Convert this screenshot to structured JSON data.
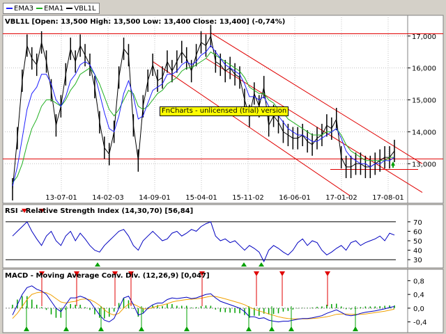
{
  "legend": {
    "items": [
      {
        "label": "EMA3",
        "color": "#2020ff"
      },
      {
        "label": "EMA1",
        "color": "#20b020"
      },
      {
        "label": "VBL1L",
        "color": "#000000"
      }
    ]
  },
  "watermark": "FnCharts - unlicensed (trial) version",
  "chart_data": [
    {
      "type": "line",
      "title": "VBL1L [Open: 13,500  High: 13,500  Low: 13,400  Close: 13,400] (-0,74%)",
      "x_tick_labels": [
        "13-07-01",
        "14-02-03",
        "14-09-01",
        "15-04-01",
        "15-11-02",
        "16-06-01",
        "17-01-02",
        "17-08-01"
      ],
      "y_tick_labels": [
        "17,000",
        "16,000",
        "15,000",
        "14,000",
        "13,000"
      ],
      "ylim": [
        12.2,
        17.3
      ],
      "series": [
        {
          "name": "VBL1L",
          "color": "#000000",
          "values": [
            12.2,
            13.8,
            15.6,
            16.7,
            16.3,
            16.1,
            16.8,
            16.2,
            15.3,
            14.2,
            14.8,
            15.8,
            16.6,
            16.2,
            16.7,
            16.4,
            16.1,
            15.4,
            14.3,
            13.5,
            13.3,
            14.0,
            15.7,
            16.6,
            16.4,
            14.2,
            13.1,
            14.8,
            15.6,
            16.1,
            15.6,
            15.7,
            16.2,
            15.9,
            16.2,
            16.5,
            16.3,
            15.9,
            16.4,
            16.8,
            16.7,
            17.0,
            16.2,
            16.1,
            15.9,
            16.0,
            15.8,
            15.7,
            15.0,
            14.5,
            15.2,
            14.8,
            15.4,
            14.2,
            14.5,
            14.3,
            14.0,
            13.9,
            13.8,
            13.8,
            13.9,
            13.7,
            13.6,
            13.8,
            13.9,
            14.2,
            14.1,
            14.4,
            13.2,
            12.9,
            12.9,
            13.0,
            13.0,
            12.9,
            12.9,
            13.0,
            13.1,
            13.2,
            13.2,
            13.4
          ]
        },
        {
          "name": "EMA3",
          "color": "#2020ff",
          "values": [
            12.3,
            12.9,
            13.8,
            14.7,
            15.2,
            15.4,
            15.8,
            15.8,
            15.5,
            15.0,
            14.8,
            15.1,
            15.6,
            15.8,
            16.1,
            16.2,
            16.1,
            15.8,
            15.2,
            14.6,
            14.1,
            14.0,
            14.5,
            15.2,
            15.6,
            15.1,
            14.4,
            14.5,
            14.9,
            15.3,
            15.4,
            15.5,
            15.8,
            15.8,
            15.9,
            16.1,
            16.2,
            16.1,
            16.2,
            16.4,
            16.5,
            16.7,
            16.5,
            16.3,
            16.1,
            16.0,
            15.9,
            15.8,
            15.5,
            15.1,
            15.1,
            15.0,
            15.1,
            14.8,
            14.7,
            14.5,
            14.3,
            14.1,
            14.0,
            13.9,
            13.9,
            13.8,
            13.7,
            13.7,
            13.8,
            13.9,
            14.0,
            14.1,
            13.8,
            13.4,
            13.2,
            13.1,
            13.0,
            13.0,
            12.9,
            13.0,
            13.0,
            13.1,
            13.1,
            13.2
          ]
        },
        {
          "name": "EMA1",
          "color": "#20b020",
          "values": [
            12.4,
            12.6,
            13.0,
            13.6,
            14.1,
            14.4,
            14.8,
            15.0,
            15.0,
            14.9,
            14.8,
            15.0,
            15.3,
            15.5,
            15.8,
            15.9,
            16.0,
            15.8,
            15.5,
            15.1,
            14.7,
            14.5,
            14.7,
            15.0,
            15.3,
            15.2,
            14.8,
            14.7,
            14.8,
            15.0,
            15.2,
            15.3,
            15.5,
            15.6,
            15.7,
            15.9,
            16.0,
            16.0,
            16.1,
            16.2,
            16.3,
            16.5,
            16.4,
            16.3,
            16.2,
            16.1,
            16.0,
            15.9,
            15.7,
            15.4,
            15.3,
            15.2,
            15.2,
            15.0,
            14.9,
            14.7,
            14.6,
            14.4,
            14.3,
            14.2,
            14.1,
            14.0,
            13.9,
            13.9,
            13.9,
            14.0,
            14.0,
            14.1,
            13.9,
            13.6,
            13.4,
            13.3,
            13.2,
            13.1,
            13.1,
            13.1,
            13.1,
            13.1,
            13.2,
            13.2
          ]
        }
      ],
      "horizontal_lines": [
        17.07,
        13.15,
        12.82
      ],
      "trend_channel": [
        {
          "from": [
            40,
            16.3
          ],
          "to": [
            79,
            12.1
          ]
        },
        {
          "from": [
            41,
            17.1
          ],
          "to": [
            79,
            13.0
          ]
        },
        {
          "from": [
            29,
            16.2
          ],
          "to": [
            64,
            12.0
          ]
        }
      ]
    },
    {
      "type": "line",
      "title": "RSI - Relative Strength Index (14,30,70) [56,84]",
      "y_tick_labels": [
        "70",
        "60",
        "50",
        "40",
        "30"
      ],
      "ylim": [
        25,
        75
      ],
      "series": [
        {
          "name": "RSI",
          "color": "#0000c0",
          "values": [
            55,
            60,
            65,
            70,
            60,
            52,
            45,
            55,
            60,
            50,
            45,
            55,
            60,
            50,
            58,
            52,
            45,
            40,
            38,
            45,
            50,
            55,
            60,
            62,
            55,
            45,
            40,
            50,
            55,
            60,
            55,
            50,
            52,
            58,
            60,
            55,
            58,
            62,
            60,
            65,
            68,
            70,
            55,
            50,
            52,
            48,
            50,
            45,
            40,
            45,
            42,
            38,
            28,
            40,
            45,
            42,
            38,
            35,
            40,
            48,
            52,
            45,
            50,
            48,
            40,
            35,
            38,
            42,
            45,
            40,
            48,
            50,
            45,
            48,
            50,
            52,
            55,
            50,
            58,
            56
          ]
        }
      ]
    },
    {
      "type": "line",
      "title": "MACD - Moving Average Conv. Div. (12,26,9) [0,047]",
      "y_tick_labels": [
        "0,8",
        "0,4",
        "0,0",
        "-0,4"
      ],
      "ylim": [
        -0.55,
        0.95
      ],
      "series": [
        {
          "name": "MACD",
          "color": "#0000c0",
          "values": [
            -0.2,
            0.1,
            0.4,
            0.6,
            0.65,
            0.55,
            0.5,
            0.4,
            0.2,
            0.0,
            -0.1,
            0.1,
            0.3,
            0.3,
            0.35,
            0.3,
            0.2,
            0.0,
            -0.2,
            -0.35,
            -0.4,
            -0.3,
            0.0,
            0.3,
            0.35,
            0.1,
            -0.2,
            -0.15,
            0.0,
            0.1,
            0.15,
            0.15,
            0.25,
            0.3,
            0.28,
            0.3,
            0.32,
            0.28,
            0.3,
            0.35,
            0.4,
            0.42,
            0.3,
            0.2,
            0.15,
            0.1,
            0.05,
            0.0,
            -0.1,
            -0.25,
            -0.25,
            -0.3,
            -0.28,
            -0.35,
            -0.38,
            -0.4,
            -0.38,
            -0.38,
            -0.35,
            -0.32,
            -0.3,
            -0.3,
            -0.28,
            -0.25,
            -0.22,
            -0.15,
            -0.1,
            -0.05,
            -0.12,
            -0.2,
            -0.22,
            -0.2,
            -0.15,
            -0.12,
            -0.1,
            -0.08,
            -0.05,
            -0.02,
            0.02,
            0.05
          ]
        },
        {
          "name": "Signal",
          "color": "#f0a000",
          "values": [
            -0.3,
            -0.15,
            0.05,
            0.25,
            0.4,
            0.45,
            0.47,
            0.45,
            0.38,
            0.28,
            0.18,
            0.15,
            0.18,
            0.2,
            0.25,
            0.27,
            0.25,
            0.18,
            0.08,
            -0.05,
            -0.15,
            -0.2,
            -0.15,
            0.0,
            0.12,
            0.12,
            0.05,
            -0.02,
            -0.02,
            0.02,
            0.06,
            0.09,
            0.13,
            0.18,
            0.21,
            0.23,
            0.25,
            0.26,
            0.27,
            0.29,
            0.32,
            0.35,
            0.34,
            0.31,
            0.27,
            0.23,
            0.19,
            0.15,
            0.1,
            0.03,
            -0.03,
            -0.08,
            -0.12,
            -0.17,
            -0.21,
            -0.25,
            -0.28,
            -0.3,
            -0.31,
            -0.31,
            -0.31,
            -0.31,
            -0.3,
            -0.29,
            -0.27,
            -0.25,
            -0.22,
            -0.18,
            -0.17,
            -0.17,
            -0.18,
            -0.18,
            -0.18,
            -0.17,
            -0.15,
            -0.13,
            -0.11,
            -0.09,
            -0.06,
            -0.03
          ]
        }
      ]
    }
  ]
}
